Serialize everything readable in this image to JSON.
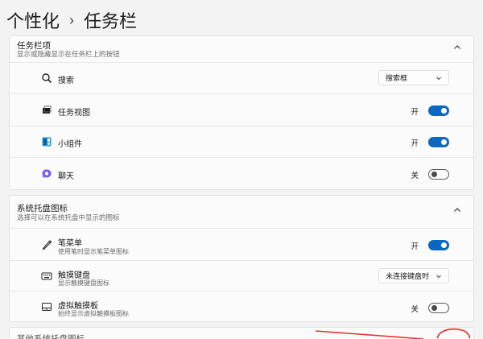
{
  "breadcrumb": {
    "parent": "个性化",
    "separator": "›",
    "current": "任务栏"
  },
  "taskbar_items": {
    "title": "任务栏项",
    "subtitle": "显示或隐藏显示在任务栏上的按钮",
    "search": {
      "label": "搜索",
      "dropdown_value": "搜索框"
    },
    "task_view": {
      "label": "任务视图",
      "state": "开",
      "on": true
    },
    "widgets": {
      "label": "小组件",
      "state": "开",
      "on": true
    },
    "chat": {
      "label": "聊天",
      "state": "关",
      "on": false
    }
  },
  "tray_icons": {
    "title": "系统托盘图标",
    "subtitle": "选择可以在系统托盘中显示的图标",
    "pen_menu": {
      "label": "笔菜单",
      "sublabel": "使用笔时显示笔菜单图标",
      "state": "开",
      "on": true
    },
    "touch_keyboard": {
      "label": "触摸键盘",
      "sublabel": "显示触摸键盘图标",
      "dropdown_value": "未连接键盘时"
    },
    "virtual_touchpad": {
      "label": "虚拟触摸板",
      "sublabel": "始终显示虚拟触摸板图标",
      "state": "关",
      "on": false
    }
  },
  "other_tray": {
    "title": "其他系统托盘图标"
  },
  "colors": {
    "accent": "#0a67c2",
    "annotation": "#e0352b"
  }
}
